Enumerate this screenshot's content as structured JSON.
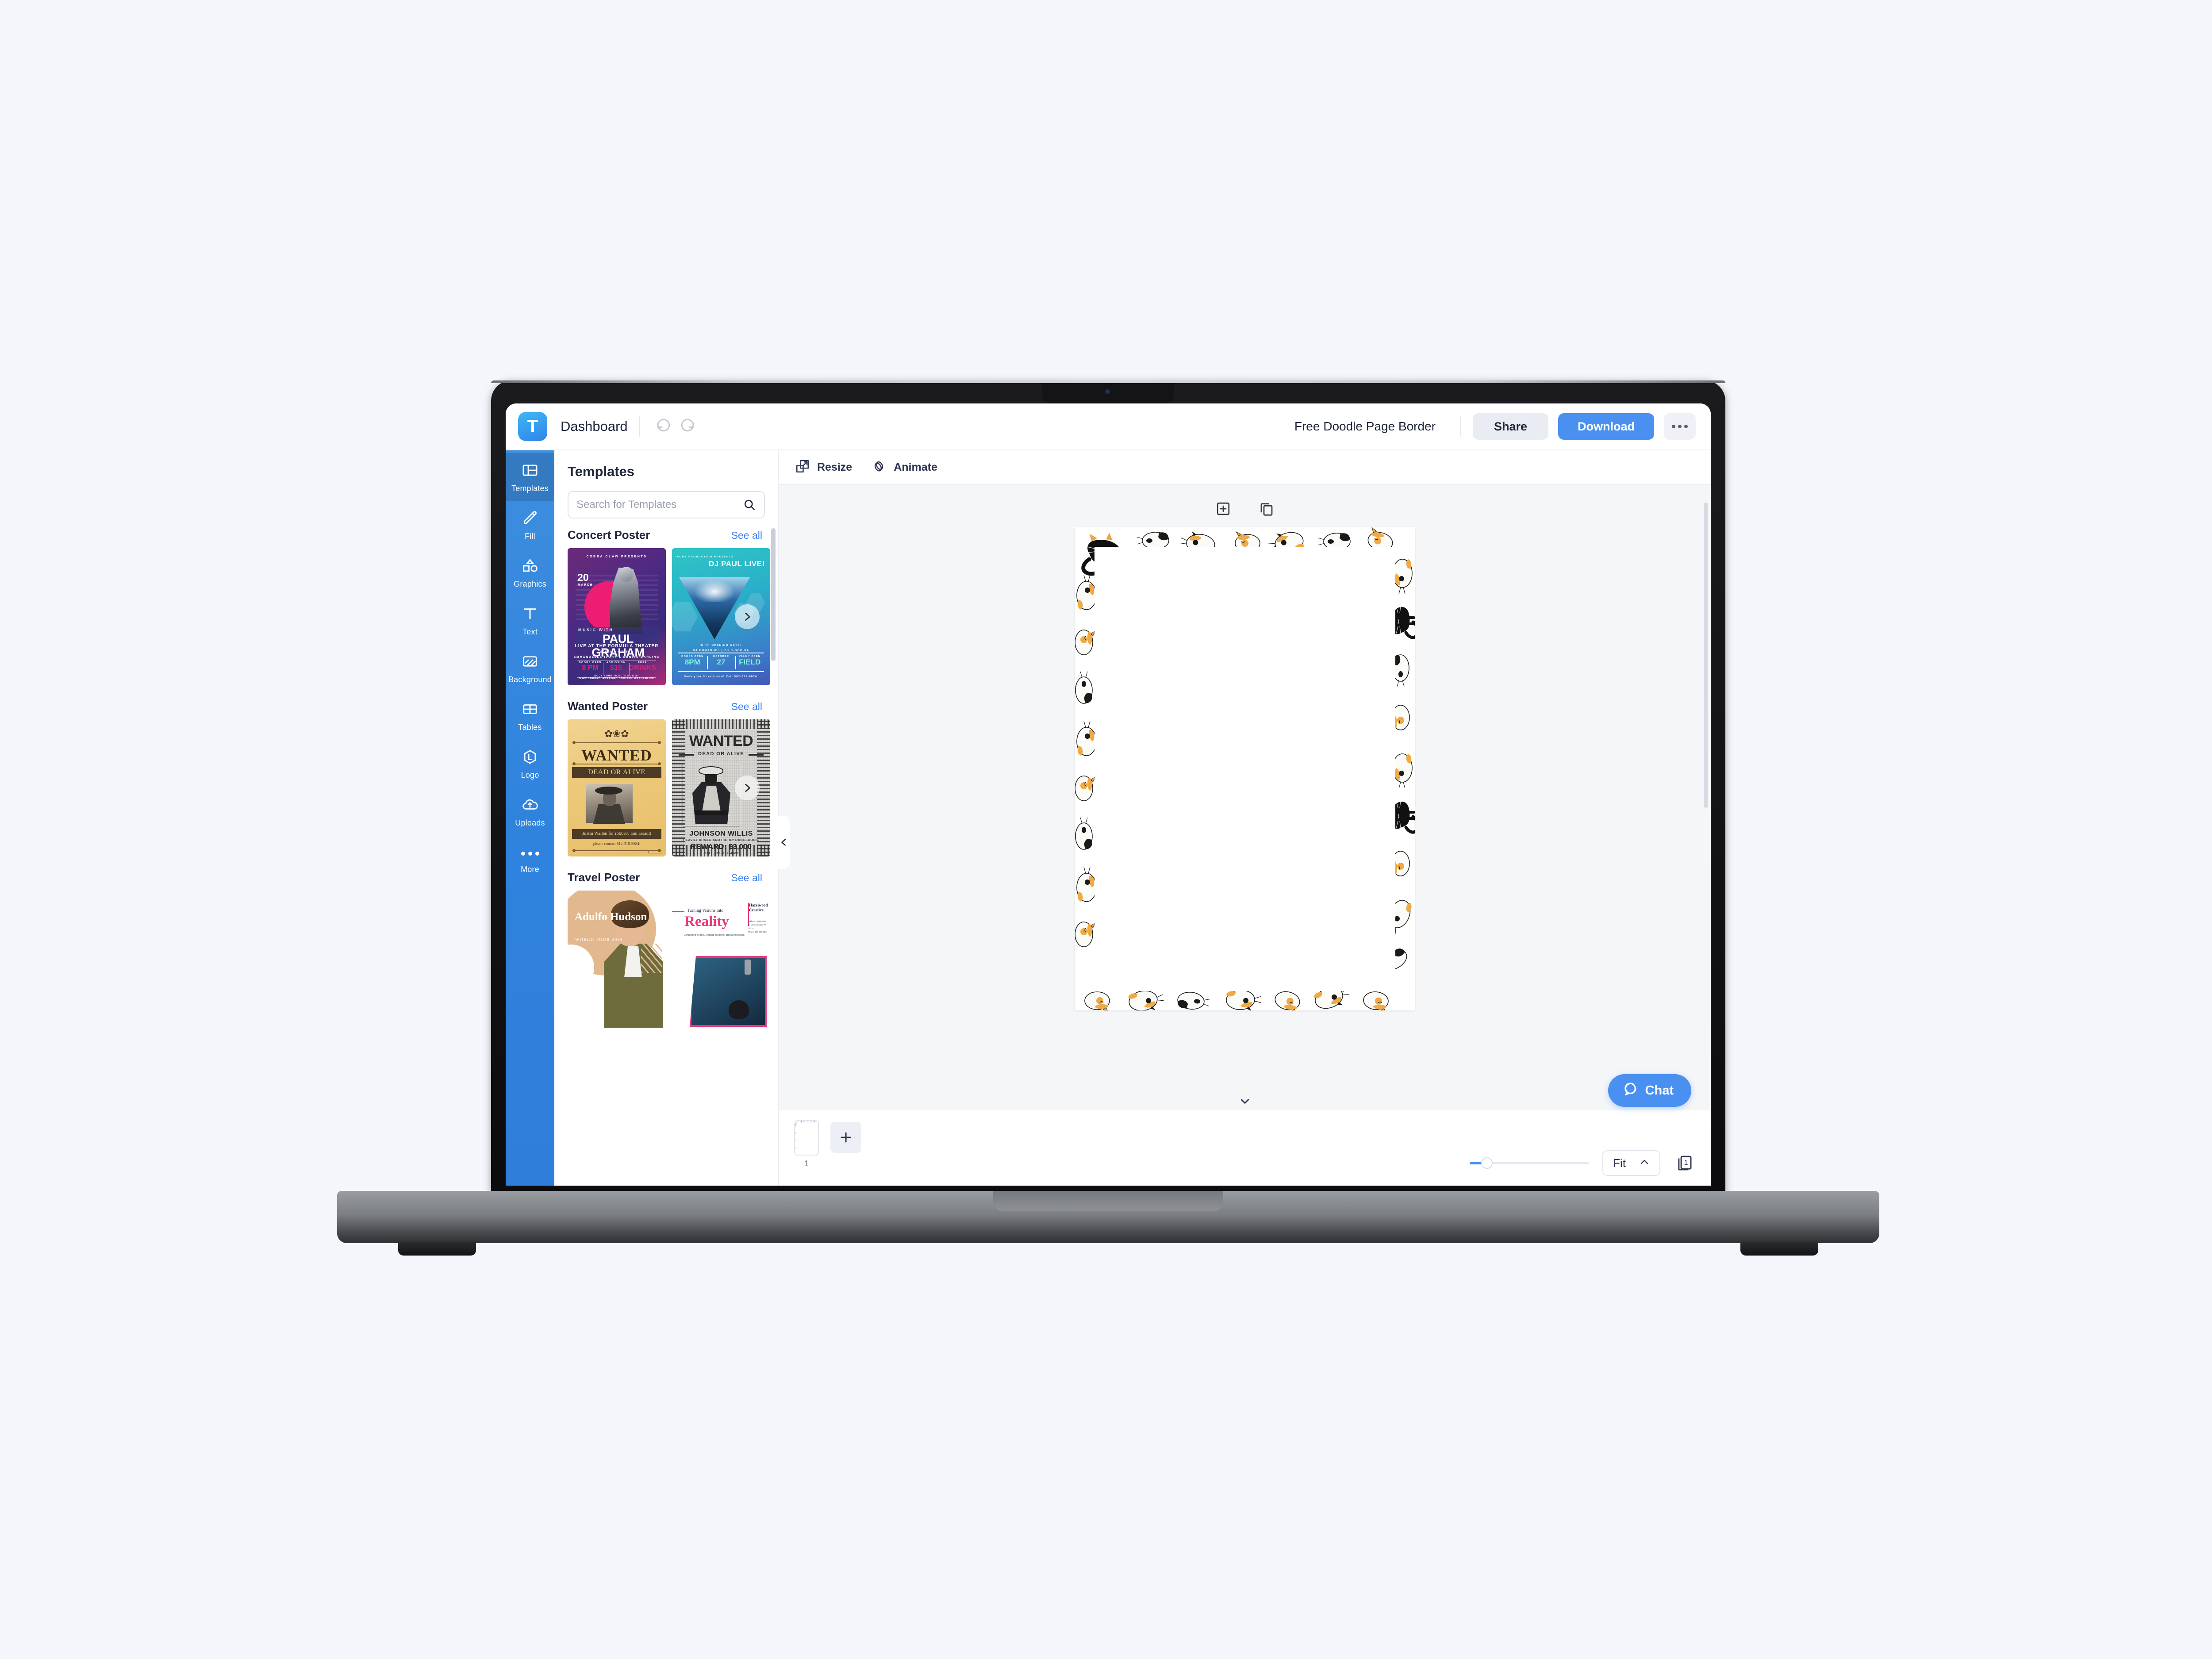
{
  "app": {
    "logo_letter": "T",
    "dashboard_label": "Dashboard",
    "doc_title": "Free Doodle Page Border",
    "share_label": "Share",
    "download_label": "Download"
  },
  "sidebar": {
    "items": [
      {
        "label": "Templates",
        "icon": "templates-icon",
        "active": true
      },
      {
        "label": "Fill",
        "icon": "pencil-icon",
        "active": false
      },
      {
        "label": "Graphics",
        "icon": "shapes-icon",
        "active": false
      },
      {
        "label": "Text",
        "icon": "text-icon",
        "active": false
      },
      {
        "label": "Background",
        "icon": "background-icon",
        "active": false
      },
      {
        "label": "Tables",
        "icon": "tables-icon",
        "active": false
      },
      {
        "label": "Logo",
        "icon": "logo-icon",
        "active": false
      },
      {
        "label": "Uploads",
        "icon": "upload-cloud-icon",
        "active": false
      },
      {
        "label": "More",
        "icon": "ellipsis-icon",
        "active": false
      }
    ]
  },
  "panel": {
    "title": "Templates",
    "search_placeholder": "Search for Templates",
    "search_value": "",
    "see_all_label": "See all",
    "sections": [
      {
        "title": "Concert Poster",
        "see_all": "See all",
        "templates": [
          {
            "kind": "concert-purple",
            "presents": "COBRA CLAW PRESENTS",
            "day": "20",
            "month": "MARCH",
            "music_with": "MUSIC WITH",
            "artist": "PAUL GRAHAM",
            "venue": "LIVE AT THE FORMULA THEATER",
            "special_guests_label": "SPECIAL GUESTS",
            "special_guests": "EMMANUELLE IVORY & DENISE DARLING",
            "info": [
              {
                "key": "DOORS OPEN",
                "value": "8 PM"
              },
              {
                "key": "ADMISSION",
                "value": "$15"
              },
              {
                "key": "FREE",
                "value": "DRINKS"
              }
            ],
            "footer": "BOOK YOUR TICKETS NOW AT WWW.COBRACLAWPROMO.COM/PAULGRAHAMLIVE"
          },
          {
            "kind": "concert-teal",
            "presents": "IVORY PRODUCTION PRESENTS",
            "title": "DJ PAUL LIVE!",
            "opening_acts_label": "WITH OPENING ACTS:",
            "opening_acts": "DJ EMMANUEL  |  DJ D-SOPHIA",
            "info": [
              {
                "key": "DOORS OPEN",
                "value": "8PM"
              },
              {
                "key": "OCTOBER",
                "value": "27"
              },
              {
                "key": "VALMY OPEN",
                "value": "FIELD"
              }
            ],
            "footer": "Book your tickets now! Call 502-023-8674."
          }
        ]
      },
      {
        "title": "Wanted Poster",
        "see_all": "See all",
        "templates": [
          {
            "kind": "wanted-gold",
            "title": "WANTED",
            "subtitle": "DEAD OR ALIVE",
            "name_line": "Justin Wallen for robbery and assault",
            "contact": "please contact 612-318-5584."
          },
          {
            "kind": "wanted-grey",
            "title": "WANTED",
            "subtitle": "DEAD OR ALIVE",
            "name": "JOHNSON WILLIS",
            "description": "HEAVILY ARMED AND HIGHLY DANGEROUS.",
            "reward": "REWARD: $3,000",
            "call": "CALL 701-332-4502"
          }
        ]
      },
      {
        "title": "Travel Poster",
        "see_all": "See all",
        "templates": [
          {
            "kind": "travel-adulfo",
            "name": "Adulfo Hudson",
            "tour": "WORLD TOUR 2025"
          },
          {
            "kind": "travel-reality",
            "eyebrow": "Turning Visions into",
            "headline": "Reality",
            "tagline": "Connecting people, creating solutions, producing results.",
            "brand": "Hazelwood Creative",
            "address": "Address: 3016 9421 Ln Vandenburgh, PA 15218",
            "phone": "Phone: 245-788-0241"
          }
        ]
      }
    ]
  },
  "editor": {
    "toolbar": [
      {
        "label": "Resize",
        "icon": "resize-icon"
      },
      {
        "label": "Animate",
        "icon": "animate-icon"
      }
    ],
    "canvas_tools": [
      {
        "icon": "add-page-box-icon"
      },
      {
        "icon": "duplicate-page-icon"
      }
    ],
    "canvas_design": "cat doodle page border"
  },
  "bottom": {
    "page_number": "1",
    "add_page_icon": "plus-icon",
    "chat_label": "Chat",
    "chat_icon": "chat-bubble-icon",
    "zoom_fit_label": "Fit",
    "zoom_chevron_icon": "chevron-up-icon",
    "pages_icon": "pages-icon",
    "pages_count": "1",
    "zoom_percent": 10
  },
  "colors": {
    "accent": "#4a90f0",
    "sidebar": "#2f82dd",
    "link": "#3b82f6",
    "text": "#20253b"
  }
}
